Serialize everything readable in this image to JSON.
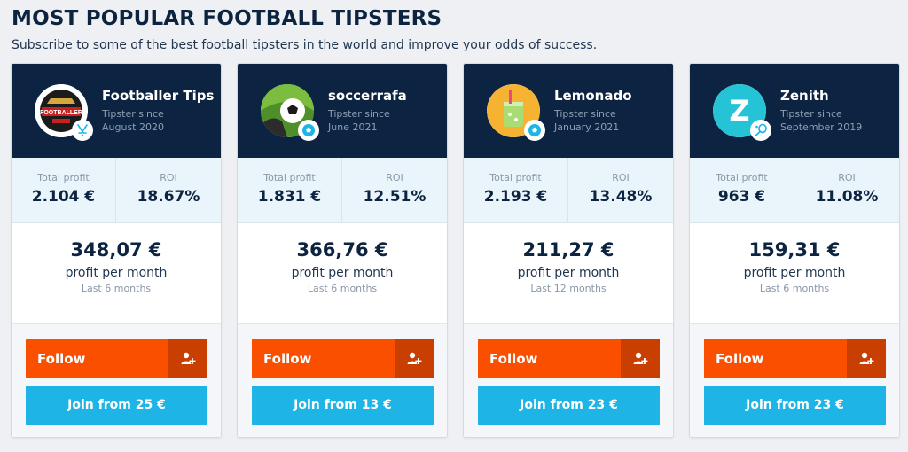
{
  "header": {
    "title": "MOST POPULAR FOOTBALL TIPSTERS",
    "subtitle": "Subscribe to some of the best football tipsters in the world and improve your odds of success."
  },
  "colors": {
    "header_bg": "#0c2341",
    "follow": "#fb4f00",
    "follow_icon_bg": "#c93f02",
    "join": "#1eb4e6",
    "stats_bg": "#eaf4fb"
  },
  "cards": [
    {
      "name": "Footballer Tips",
      "avatar_icon": "footballer-tips-logo-icon",
      "avatar_text": "FOOTBALLER",
      "sport_icon": "hockey-sticks-icon",
      "since_label": "Tipster since",
      "since_date": "August 2020",
      "total_profit_label": "Total profit",
      "total_profit": "2.104 €",
      "roi_label": "ROI",
      "roi": "18.67%",
      "monthly_profit": "348,07 €",
      "monthly_label": "profit per month",
      "period": "Last 6 months",
      "follow_label": "Follow",
      "follow_icon": "add-user-icon",
      "join_label": "Join from 25 €"
    },
    {
      "name": "soccerrafa",
      "avatar_icon": "soccer-ball-on-grass-icon",
      "sport_icon": "soccer-ball-icon",
      "since_label": "Tipster since",
      "since_date": "June 2021",
      "total_profit_label": "Total profit",
      "total_profit": "1.831 €",
      "roi_label": "ROI",
      "roi": "12.51%",
      "monthly_profit": "366,76 €",
      "monthly_label": "profit per month",
      "period": "Last 6 months",
      "follow_label": "Follow",
      "follow_icon": "add-user-icon",
      "join_label": "Join from 13 €"
    },
    {
      "name": "Lemonado",
      "avatar_icon": "lemonade-drink-icon",
      "sport_icon": "soccer-ball-icon",
      "since_label": "Tipster since",
      "since_date": "January 2021",
      "total_profit_label": "Total profit",
      "total_profit": "2.193 €",
      "roi_label": "ROI",
      "roi": "13.48%",
      "monthly_profit": "211,27 €",
      "monthly_label": "profit per month",
      "period": "Last 12 months",
      "follow_label": "Follow",
      "follow_icon": "add-user-icon",
      "join_label": "Join from 23 €"
    },
    {
      "name": "Zenith",
      "avatar_icon": "letter-z-logo-icon",
      "avatar_text": "Z",
      "sport_icon": "tennis-racket-icon",
      "since_label": "Tipster since",
      "since_date": "September 2019",
      "total_profit_label": "Total profit",
      "total_profit": "963 €",
      "roi_label": "ROI",
      "roi": "11.08%",
      "monthly_profit": "159,31 €",
      "monthly_label": "profit per month",
      "period": "Last 6 months",
      "follow_label": "Follow",
      "follow_icon": "add-user-icon",
      "join_label": "Join from 23 €"
    }
  ]
}
